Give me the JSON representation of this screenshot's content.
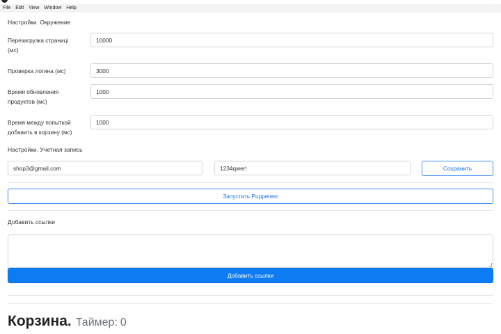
{
  "menu": [
    "File",
    "Edit",
    "View",
    "Window",
    "Help"
  ],
  "environment": {
    "title": "Настройки. Окружение",
    "fields": [
      {
        "label_lines": [
          "Перезагрузка страниці",
          "(мс)"
        ],
        "value": "10000"
      },
      {
        "label_lines": [
          "Проверка логина (мс)"
        ],
        "value": "3000"
      },
      {
        "label_lines": [
          "Время обновления",
          "продуктов (мс)"
        ],
        "value": "1000"
      },
      {
        "label_lines": [
          "Время между попыткой",
          "добавить в корзину (мс)"
        ],
        "value": "1000"
      }
    ]
  },
  "account": {
    "title": "Настройки. Учетная запись",
    "email": "shop3@gmail.com",
    "password": "1234qwer!",
    "save_label": "Сохранить"
  },
  "launch_label": "Запустить Puppeteer",
  "links": {
    "title": "Добавить ссылки",
    "textarea_value": "",
    "add_label": "Добавить ссылки"
  },
  "cart": {
    "title": "Корзина.",
    "timer_label": "Таймер:",
    "timer_value": "0"
  }
}
